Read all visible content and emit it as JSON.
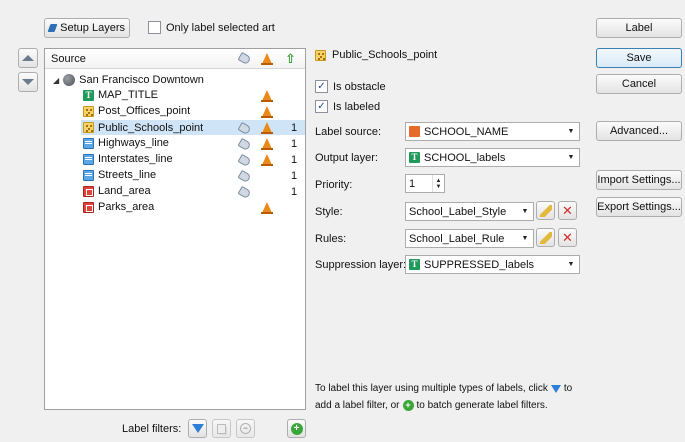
{
  "toolbar": {
    "setup_layers": "Setup Layers",
    "only_label_selected": "Only label selected art"
  },
  "tree": {
    "header": "Source",
    "root": "San Francisco Downtown",
    "items": [
      {
        "name": "MAP_TITLE",
        "icon": "text-layer-icon",
        "tag": false,
        "cone": true,
        "count": ""
      },
      {
        "name": "Post_Offices_point",
        "icon": "point-layer-icon",
        "tag": false,
        "cone": true,
        "count": ""
      },
      {
        "name": "Public_Schools_point",
        "icon": "point-layer-icon",
        "tag": true,
        "cone": true,
        "count": "1"
      },
      {
        "name": "Highways_line",
        "icon": "line-layer-icon",
        "tag": true,
        "cone": true,
        "count": "1"
      },
      {
        "name": "Interstates_line",
        "icon": "line-layer-icon",
        "tag": true,
        "cone": true,
        "count": "1"
      },
      {
        "name": "Streets_line",
        "icon": "line-layer-icon",
        "tag": true,
        "cone": false,
        "count": "1"
      },
      {
        "name": "Land_area",
        "icon": "area-layer-icon",
        "tag": true,
        "cone": false,
        "count": "1"
      },
      {
        "name": "Parks_area",
        "icon": "area-layer-icon",
        "tag": false,
        "cone": true,
        "count": ""
      }
    ]
  },
  "filters_label": "Label filters:",
  "detail": {
    "layer_name": "Public_Schools_point",
    "is_obstacle": "Is obstacle",
    "is_labeled": "Is labeled",
    "label_source_label": "Label source:",
    "label_source_value": "SCHOOL_NAME",
    "output_layer_label": "Output layer:",
    "output_layer_value": "SCHOOL_labels",
    "priority_label": "Priority:",
    "priority_value": "1",
    "style_label": "Style:",
    "style_value": "School_Label_Style",
    "rules_label": "Rules:",
    "rules_value": "School_Label_Rule",
    "suppression_label": "Suppression layer:",
    "suppression_value": "SUPPRESSED_labels",
    "help_line1_a": "To label this layer using multiple types of labels, click",
    "help_line1_b": "to",
    "help_line2_a": "add a label filter, or",
    "help_line2_b": "to batch generate label filters."
  },
  "buttons": {
    "label": "Label",
    "save": "Save",
    "cancel": "Cancel",
    "advanced": "Advanced...",
    "import": "Import Settings...",
    "export": "Export Settings..."
  }
}
